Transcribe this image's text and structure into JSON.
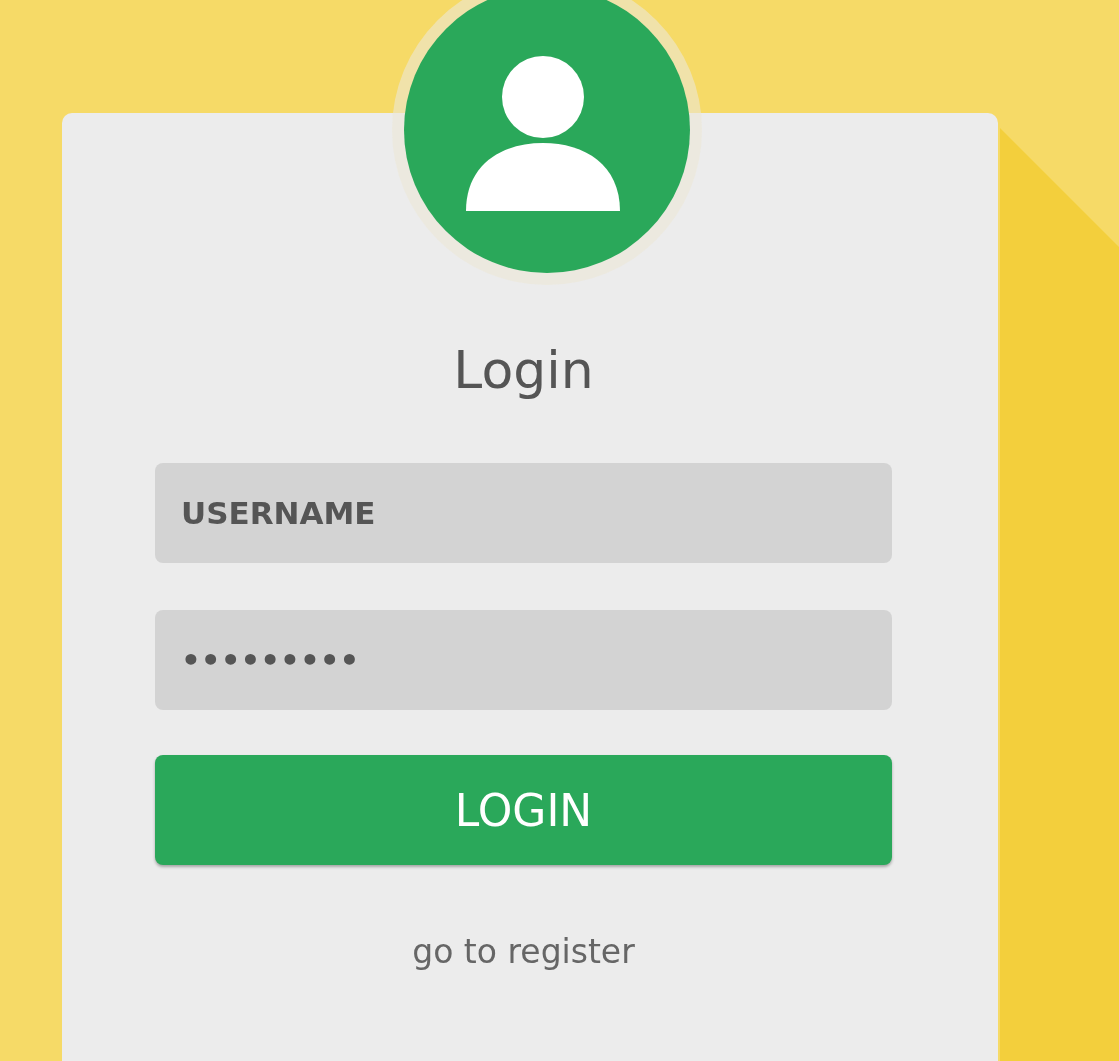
{
  "login_form": {
    "title": "Login",
    "username": {
      "placeholder": "USERNAME"
    },
    "password": {
      "value": "•••••••••"
    },
    "submit_button": {
      "label": "LOGIN"
    },
    "register_link": {
      "label": "go to register"
    }
  }
}
